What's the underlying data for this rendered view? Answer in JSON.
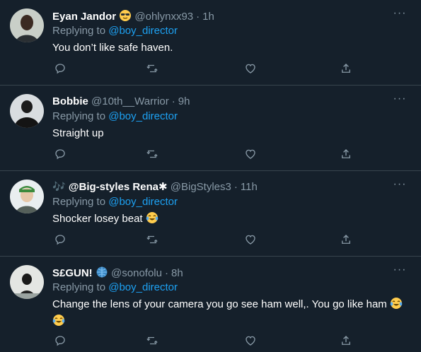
{
  "tweets": [
    {
      "name": "Eyan Jandor",
      "name_emoji": "sunglasses-emoji",
      "handle": "@ohlynxx93",
      "time": "1h",
      "reply_prefix": "Replying to",
      "reply_to": "@boy_director",
      "text": "You don’t like safe haven.",
      "text_emoji": ""
    },
    {
      "name": "Bobbie",
      "handle": "@10th__Warrior",
      "time": "9h",
      "reply_prefix": "Replying to",
      "reply_to": "@boy_director",
      "text": "Straight up",
      "text_emoji": ""
    },
    {
      "name_prefix": "🎶",
      "name": "@Big-styles Rena✱",
      "handle": "@BigStyles3",
      "time": "11h",
      "reply_prefix": "Replying to",
      "reply_to": "@boy_director",
      "text": "Shocker losey beat",
      "text_emoji": "tears-of-joy-emoji"
    },
    {
      "name": "S£GUN!",
      "name_emoji": "globe-emoji",
      "handle": "@sonofolu",
      "time": "8h",
      "reply_prefix": "Replying to",
      "reply_to": "@boy_director",
      "text": "Change the lens of your camera you go see ham well,. You go like ham",
      "text_emoji": "tears-of-joy-emoji"
    }
  ],
  "separator": "·",
  "more_glyph": "···",
  "colors": {
    "background": "#15202b",
    "border": "#38444d",
    "secondary_text": "#8899a6",
    "mention": "#1da1f2",
    "primary_text": "#ffffff"
  },
  "icons": [
    "reply-icon",
    "retweet-icon",
    "like-icon",
    "share-icon",
    "more-icon"
  ]
}
